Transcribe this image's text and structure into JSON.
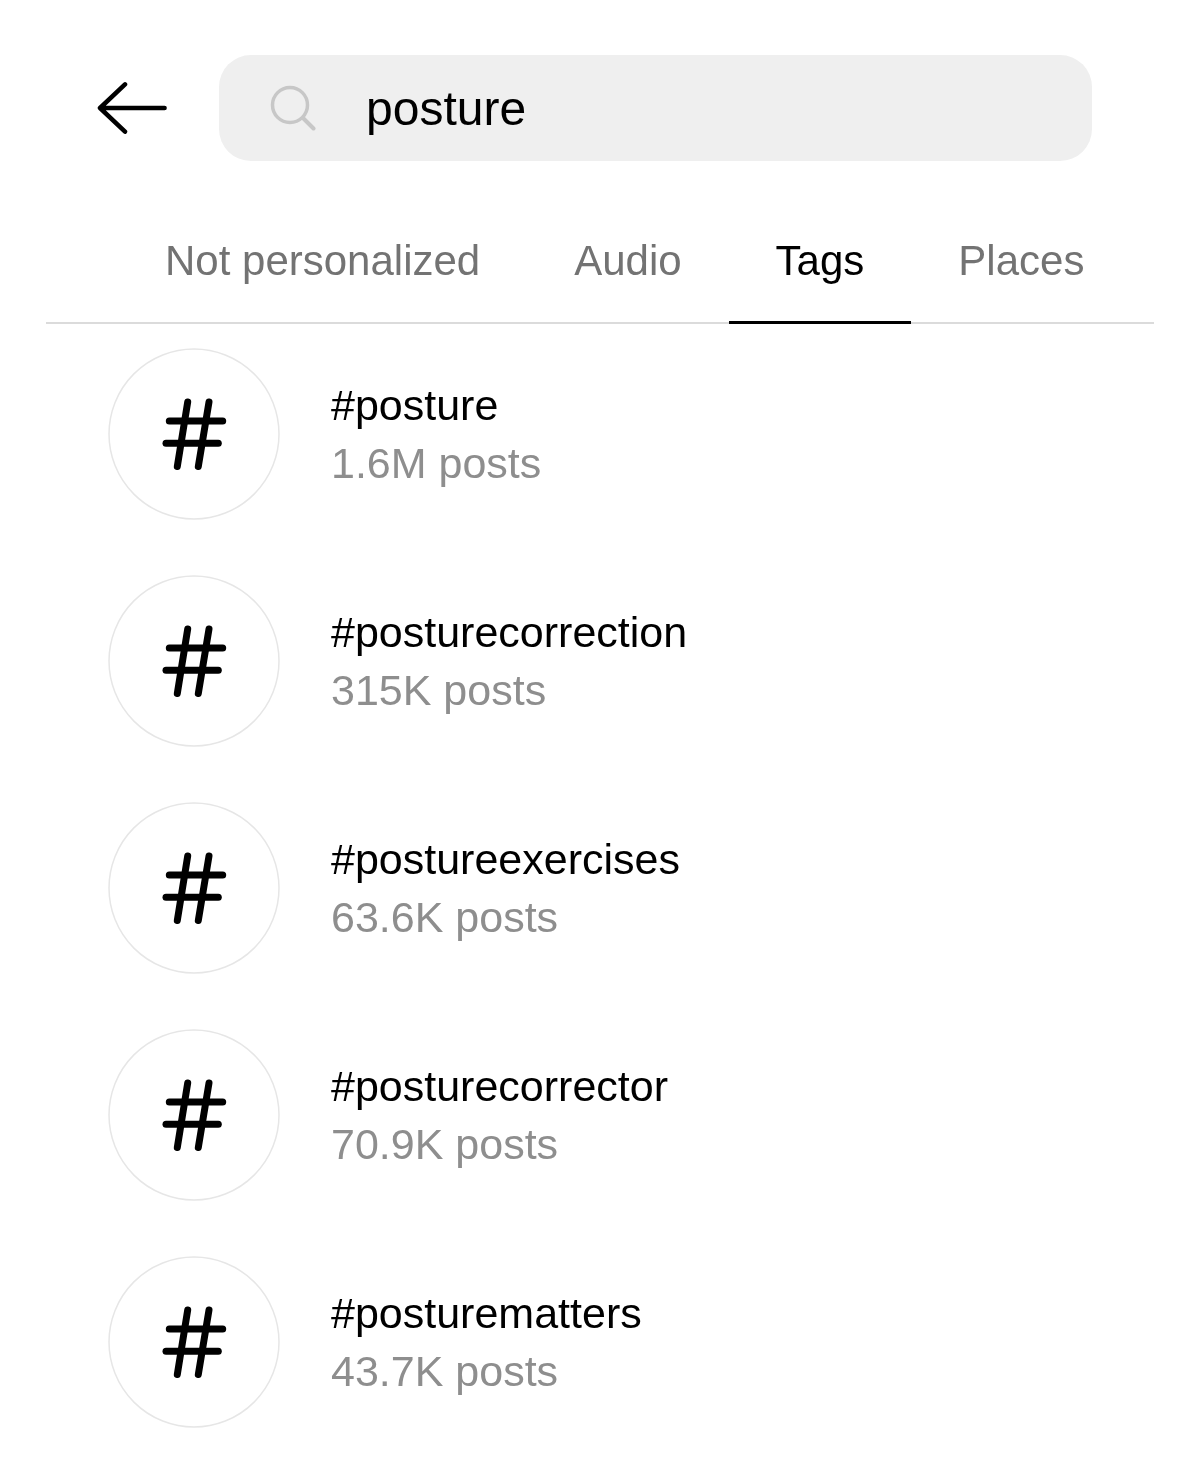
{
  "search": {
    "value": "posture"
  },
  "tabs": [
    {
      "label": "Not personalized",
      "selected": false
    },
    {
      "label": "Audio",
      "selected": false
    },
    {
      "label": "Tags",
      "selected": true
    },
    {
      "label": "Places",
      "selected": false
    }
  ],
  "results": [
    {
      "tag": "#posture",
      "posts": "1.6M posts"
    },
    {
      "tag": "#posturecorrection",
      "posts": "315K posts"
    },
    {
      "tag": "#postureexercises",
      "posts": "63.6K posts"
    },
    {
      "tag": "#posturecorrector",
      "posts": "70.9K posts"
    },
    {
      "tag": "#posturematters",
      "posts": "43.7K posts"
    }
  ]
}
